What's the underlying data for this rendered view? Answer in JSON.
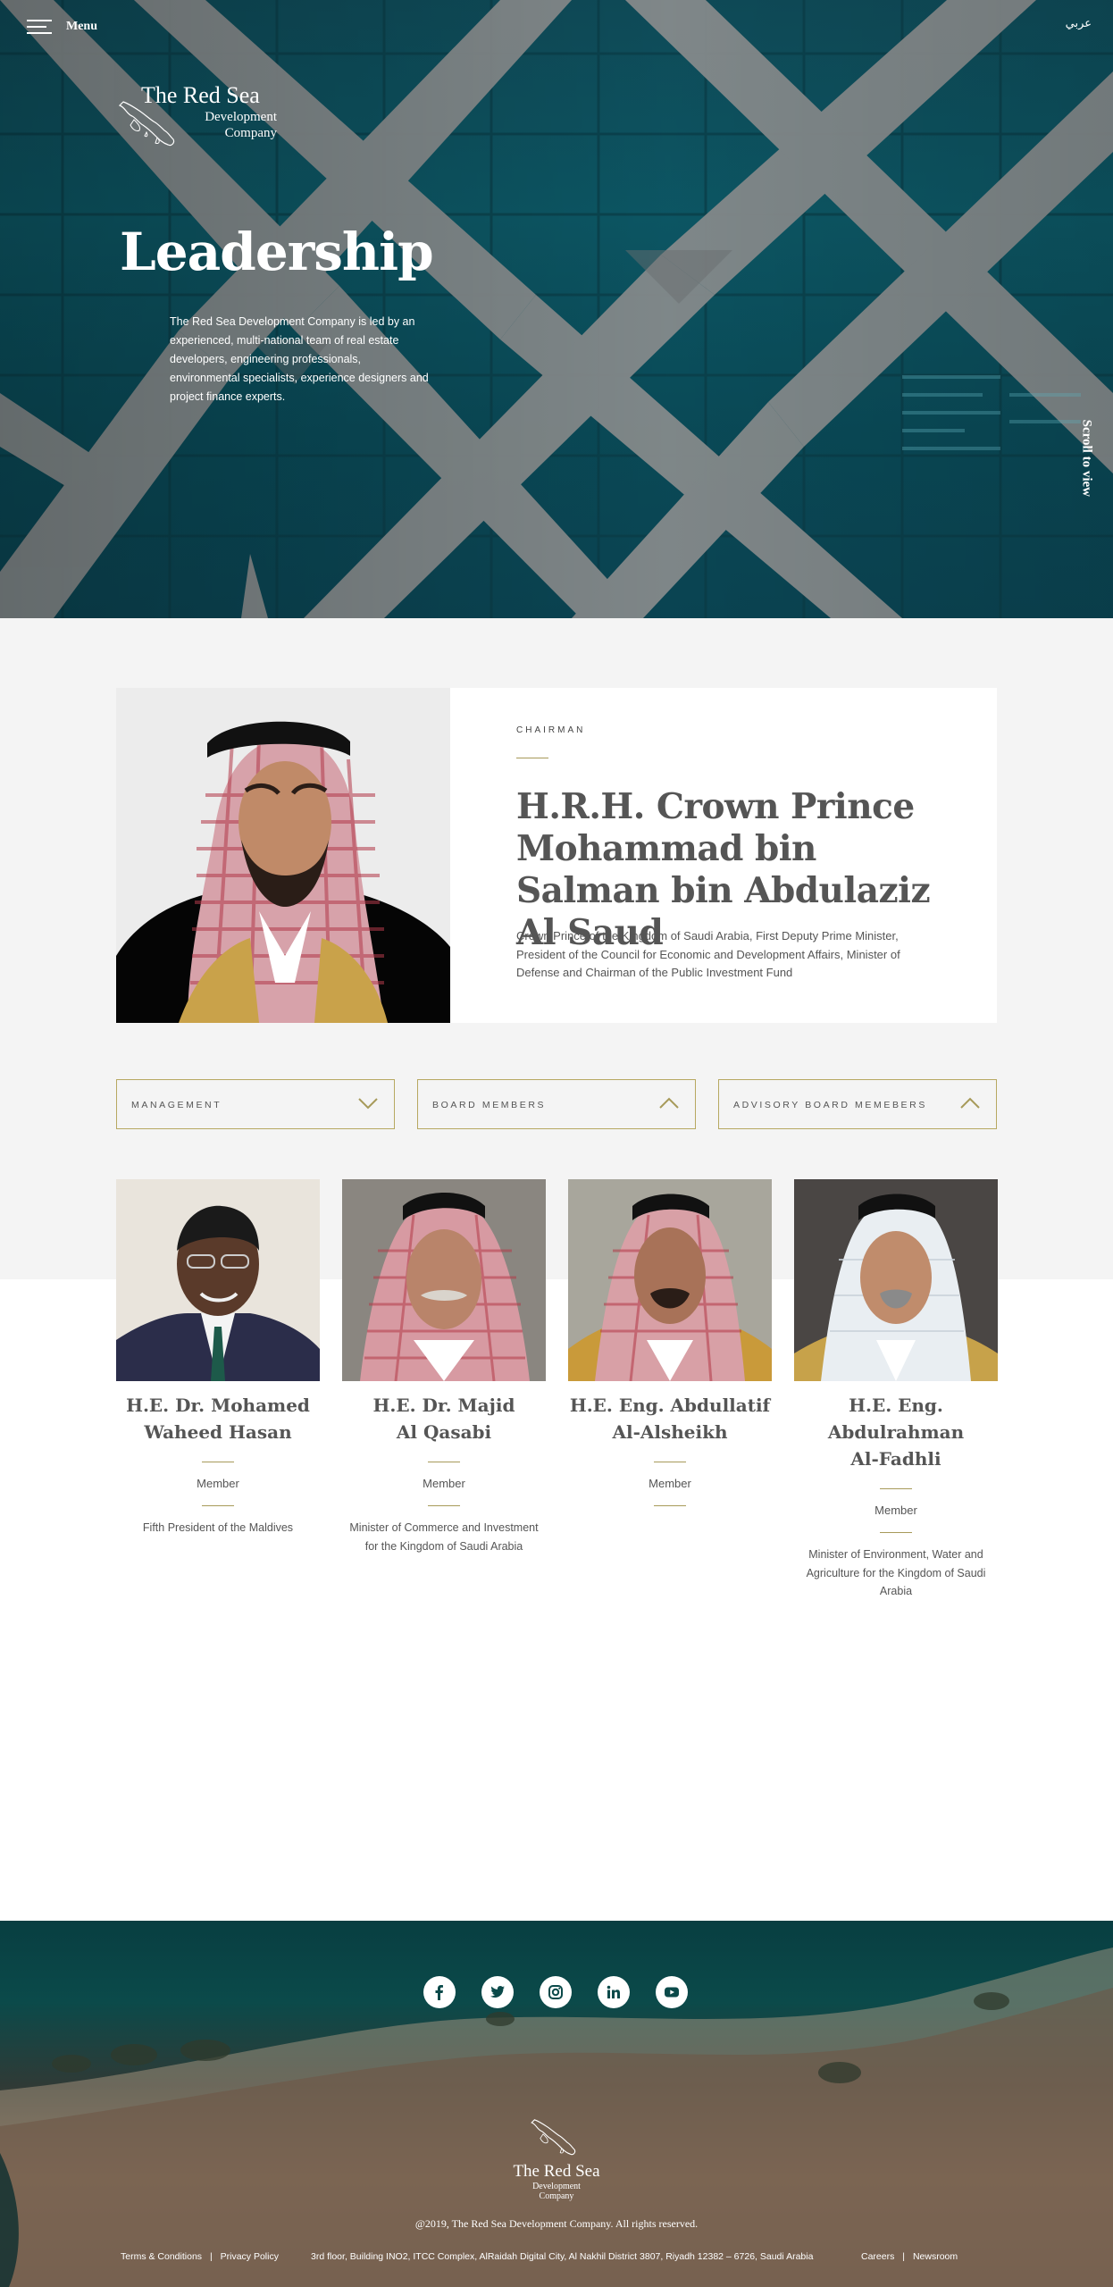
{
  "header": {
    "menu_label": "Menu",
    "language_link": "عربي"
  },
  "logo": {
    "title": "The Red Sea",
    "subtitle_line1": "Development",
    "subtitle_line2": "Company"
  },
  "hero": {
    "title": "Leadership",
    "description": "The Red Sea Development Company is led by an experienced, multi-national team of real estate developers, engineering professionals, environmental specialists, experience designers and project finance experts.",
    "scroll_hint": "Scroll to view"
  },
  "chairman": {
    "role": "CHAIRMAN",
    "name": "H.R.H. Crown Prince Mohammad bin Salman bin Abdulaziz Al Saud",
    "description": "Crown Prince of the Kingdom of Saudi Arabia, First Deputy Prime Minister, President of the Council for Economic and Development Affairs, Minister of Defense and Chairman of the Public Investment Fund"
  },
  "filters": [
    {
      "label": "MANAGEMENT",
      "state": "collapsed"
    },
    {
      "label": "BOARD MEMBERS",
      "state": "expanded"
    },
    {
      "label": "ADVISORY BOARD MEMEBERS",
      "state": "expanded"
    }
  ],
  "members": [
    {
      "name_line1": "H.E. Dr. Mohamed",
      "name_line2": "Waheed Hasan",
      "role": "Member",
      "description": "Fifth President of the Maldives"
    },
    {
      "name_line1": "H.E. Dr. Majid",
      "name_line2": "Al Qasabi",
      "role": "Member",
      "description": "Minister of Commerce and Investment for the Kingdom of Saudi Arabia"
    },
    {
      "name_line1": "H.E. Eng. Abdullatif",
      "name_line2": "Al-Alsheikh",
      "role": "Member",
      "description": ""
    },
    {
      "name_line1": "H.E. Eng. Abdulrahman",
      "name_line2": "Al-Fadhli",
      "role": "Member",
      "description": "Minister of Environment, Water and Agriculture for the Kingdom of Saudi Arabia"
    }
  ],
  "footer": {
    "social_icons": [
      "facebook-icon",
      "twitter-icon",
      "instagram-icon",
      "linkedin-icon",
      "youtube-icon"
    ],
    "logo_title": "The Red Sea",
    "logo_sub1": "Development",
    "logo_sub2": "Company",
    "copyright": "@2019, The Red Sea Development Company. All rights reserved.",
    "terms": "Terms & Conditions",
    "privacy": "Privacy Policy",
    "address": "3rd floor, Building INO2, ITCC Complex, AlRaidah Digital City, Al Nakhil District 3807, Riyadh 12382 – 6726, Saudi Arabia",
    "careers": "Careers",
    "newsroom": "Newsroom",
    "separator": "|"
  },
  "colors": {
    "accent_gold": "#a79a5a",
    "hero_teal": "#0d5a68",
    "grey_band": "#f4f4f4",
    "text": "#555555"
  }
}
